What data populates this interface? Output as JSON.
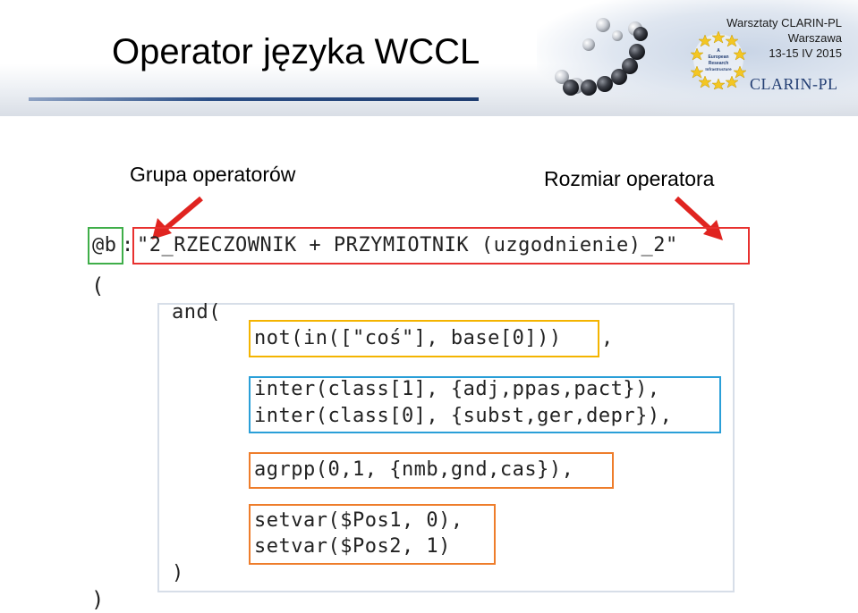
{
  "slide": {
    "title": "Operator języka WCCL",
    "info": {
      "line1": "Warsztaty CLARIN-PL",
      "line2": "Warszawa",
      "line3": "13-15 IV 2015"
    },
    "logo_text": "CLARIN-PL",
    "eu_badge_text": [
      "A",
      "European",
      "Research",
      "Infrastructure"
    ]
  },
  "labels": {
    "group": "Grupa operatorów",
    "size": "Rozmiar operatora"
  },
  "code": {
    "header_at": "@b",
    "header_colon": ":",
    "header_name": "\"2_RZECZOWNIK + PRZYMIOTNIK (uzgodnienie)_2\"",
    "open_paren": "(",
    "and_open": "and(",
    "not_line": "not(in([\"coś\"], base[0]))",
    "not_comma": ",",
    "inter1": "inter(class[1], {adj,ppas,pact}),",
    "inter2": "inter(class[0], {subst,ger,depr}),",
    "agrpp": "agrpp(0,1, {nmb,gnd,cas}),",
    "setvar1": "setvar($Pos1, 0),",
    "setvar2": "setvar($Pos2, 1)",
    "inner_close": ")",
    "close_paren": ")"
  },
  "colors": {
    "green_box": "#3fae49",
    "red_box": "#e8312f",
    "yellow_box": "#f4b400",
    "blue_box": "#2a9fd8",
    "orange_box": "#ee7d2b",
    "arrow": "#e02420",
    "title_bar": "#2b4e86"
  }
}
